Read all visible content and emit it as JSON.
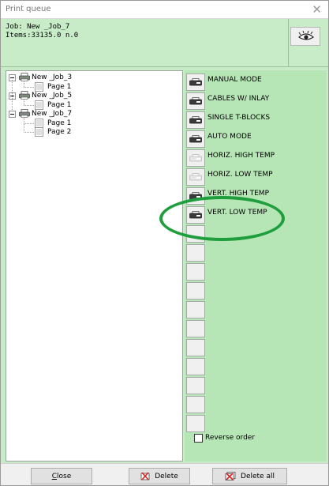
{
  "window": {
    "title": "Print queue",
    "close_glyph": "✕"
  },
  "info": {
    "job_line": "Job: New _Job_7",
    "items_line": "Items:33135.0 n.0"
  },
  "eye_button": {
    "icon": "eye-preview-icon"
  },
  "tree": {
    "jobs": [
      {
        "label": "New _Job_3",
        "pages": [
          "Page 1"
        ]
      },
      {
        "label": "New _Job_5",
        "pages": [
          "Page 1"
        ]
      },
      {
        "label": "New _Job_7",
        "pages": [
          "Page 1",
          "Page 2"
        ]
      }
    ]
  },
  "modes": [
    {
      "label": "MANUAL MODE",
      "enabled": true
    },
    {
      "label": "CABLES W/ INLAY",
      "enabled": true
    },
    {
      "label": "SINGLE T-BLOCKS",
      "enabled": true
    },
    {
      "label": "AUTO MODE",
      "enabled": true
    },
    {
      "label": "HORIZ. HIGH TEMP",
      "enabled": false
    },
    {
      "label": "HORIZ. LOW TEMP",
      "enabled": false
    },
    {
      "label": "VERT. HIGH TEMP",
      "enabled": true
    },
    {
      "label": "VERT. LOW TEMP",
      "enabled": true
    }
  ],
  "reverse_order": {
    "label": "Reverse order",
    "checked": false
  },
  "buttons": {
    "close": "Close",
    "delete": "Delete",
    "delete_all": "Delete all"
  },
  "colors": {
    "panel_green": "#c8ecc8",
    "slot_green": "#b6e6b6",
    "annotation_ellipse": "#1e9e3c"
  }
}
